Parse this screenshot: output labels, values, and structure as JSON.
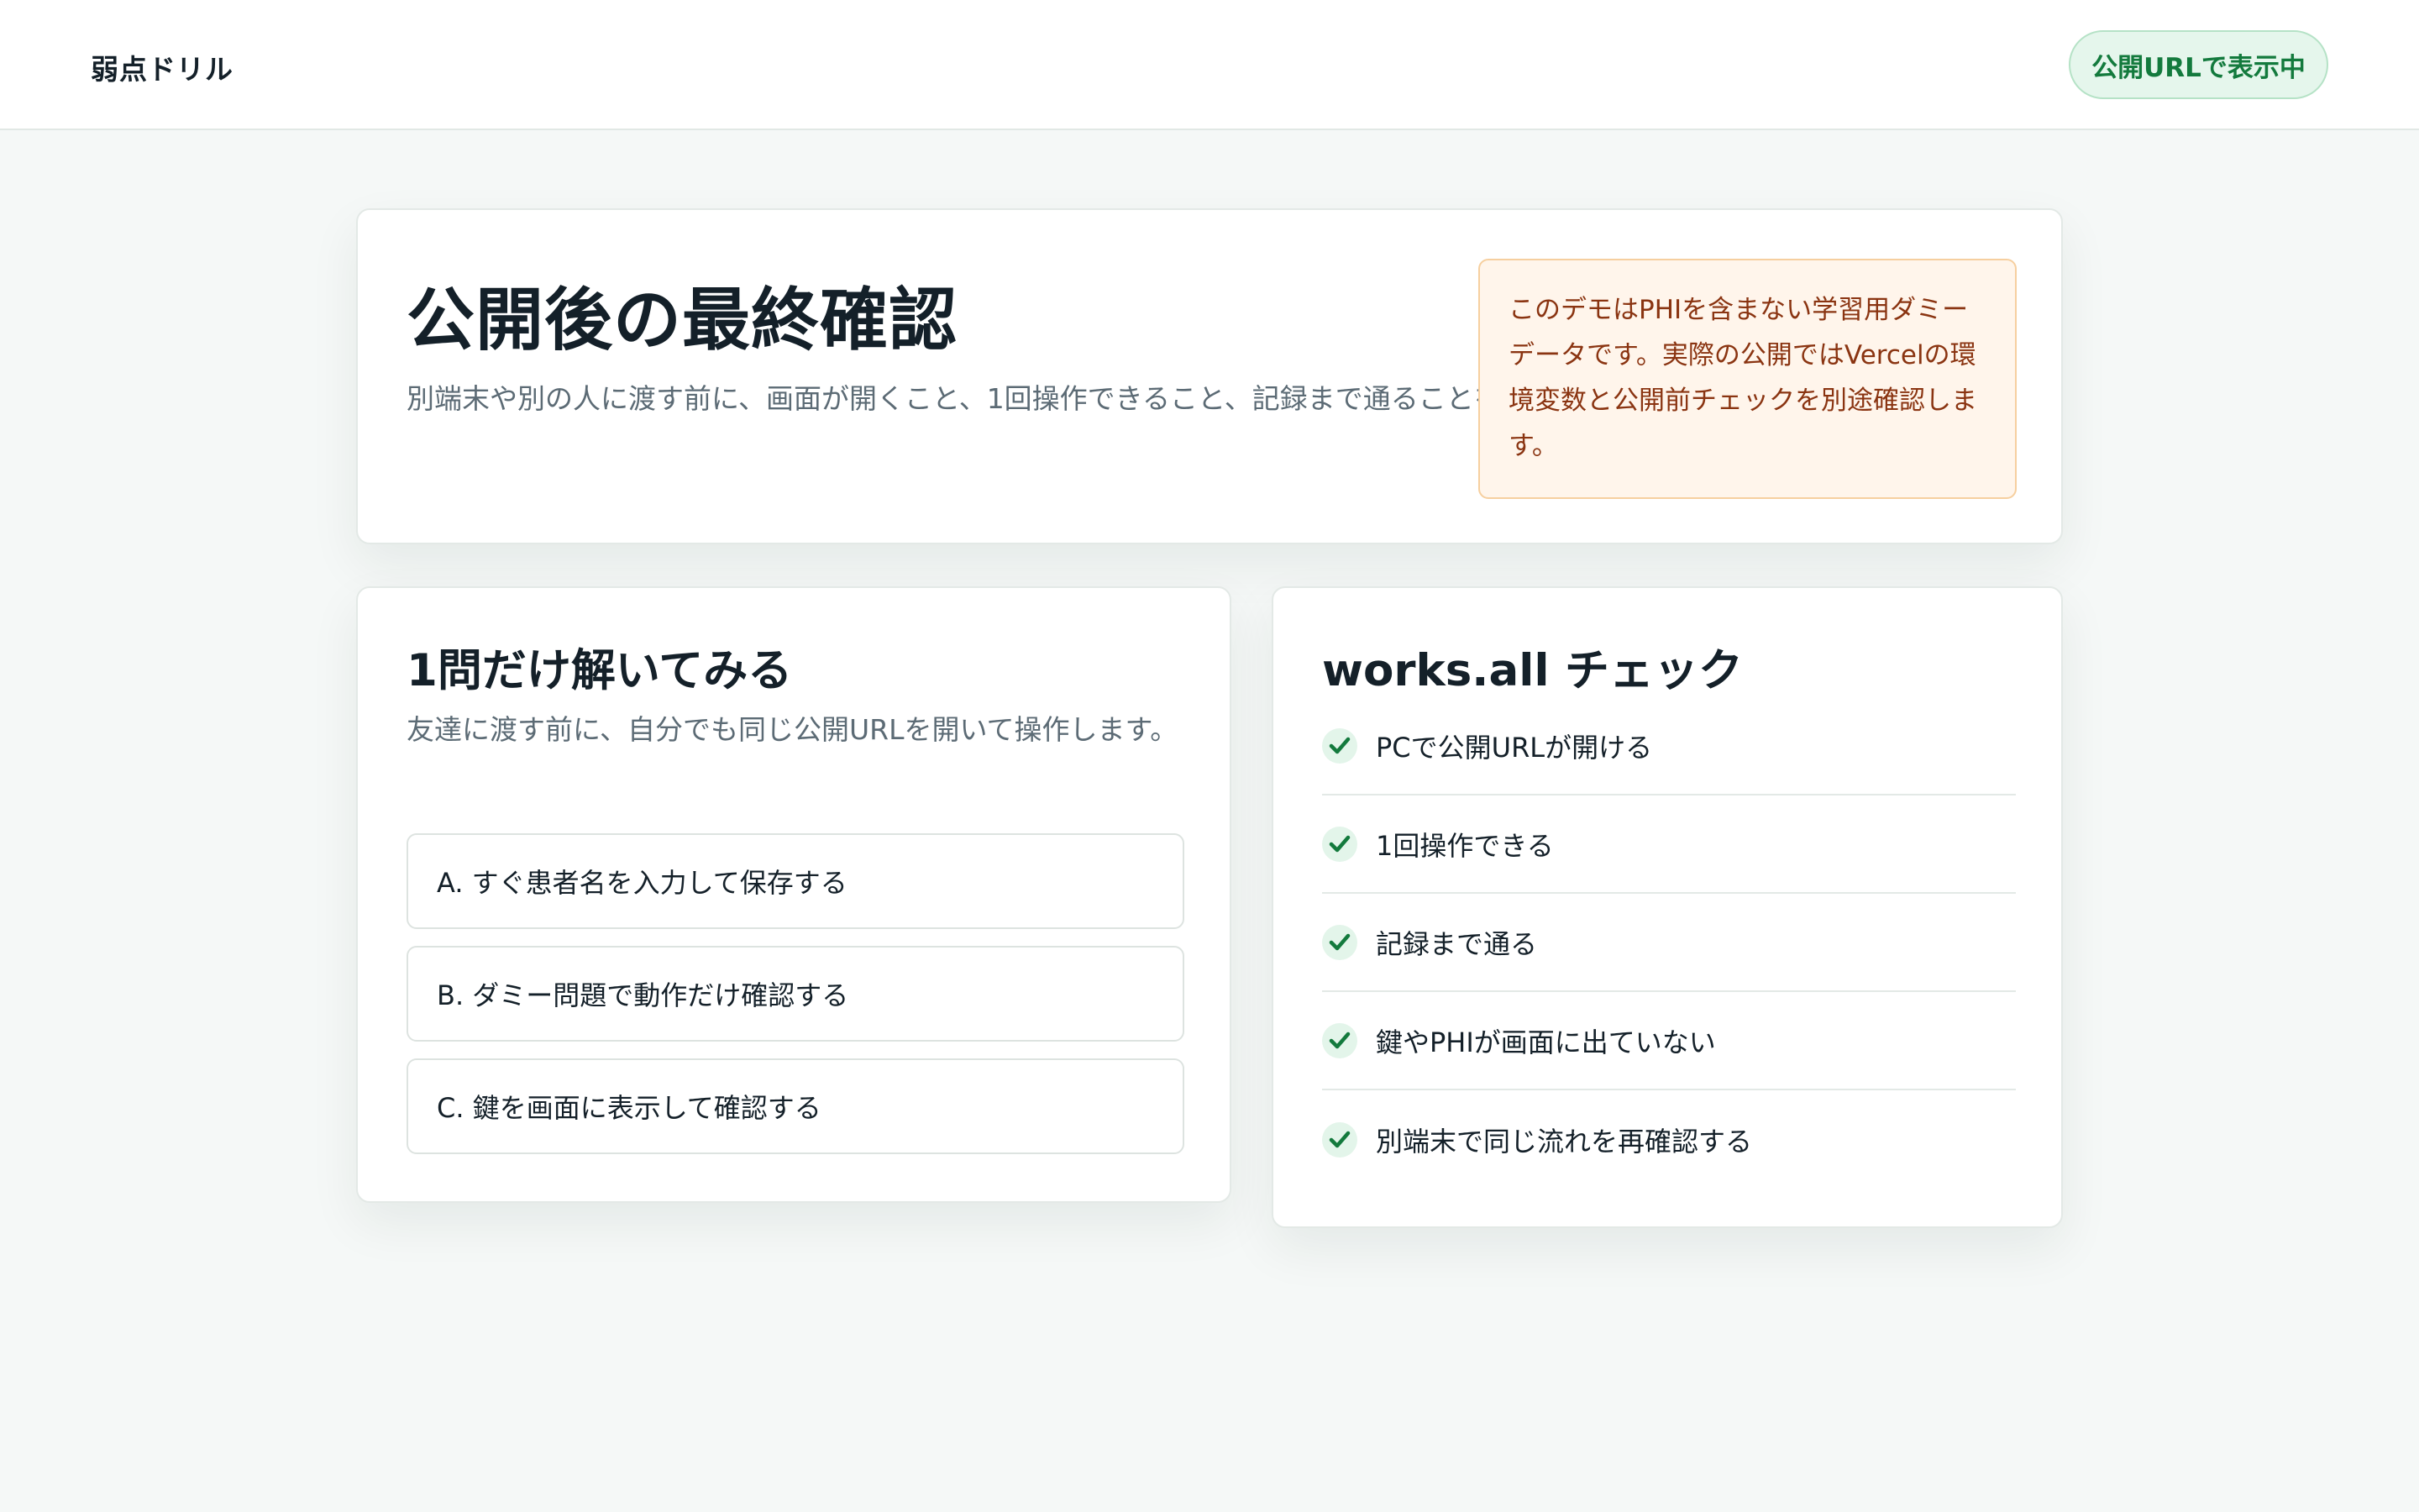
{
  "header": {
    "brand": "弱点ドリル",
    "status": "公開URLで表示中"
  },
  "hero": {
    "title": "公開後の最終確認",
    "description": "別端末や別の人に渡す前に、画面が開くこと、1回操作できること、記録まで通ることを見ます。",
    "notice": "このデモはPHIを含まない学習用ダミーデータです。実際の公開ではVercelの環境変数と公開前チェックを別途確認します。"
  },
  "quiz": {
    "title": "1問だけ解いてみる",
    "description": "友達に渡す前に、自分でも同じ公開URLを開いて操作します。",
    "options": [
      "A. すぐ患者名を入力して保存する",
      "B. ダミー問題で動作だけ確認する",
      "C. 鍵を画面に表示して確認する"
    ]
  },
  "checklist": {
    "title": "works.all チェック",
    "items": [
      "PCで公開URLが開ける",
      "1回操作できる",
      "記録まで通る",
      "鍵やPHIが画面に出ていない",
      "別端末で同じ流れを再確認する"
    ]
  },
  "colors": {
    "accent_green": "#137a3d",
    "notice_bg": "#fff5eb",
    "notice_text": "#8a3411",
    "page_bg": "#f5f8f7"
  }
}
